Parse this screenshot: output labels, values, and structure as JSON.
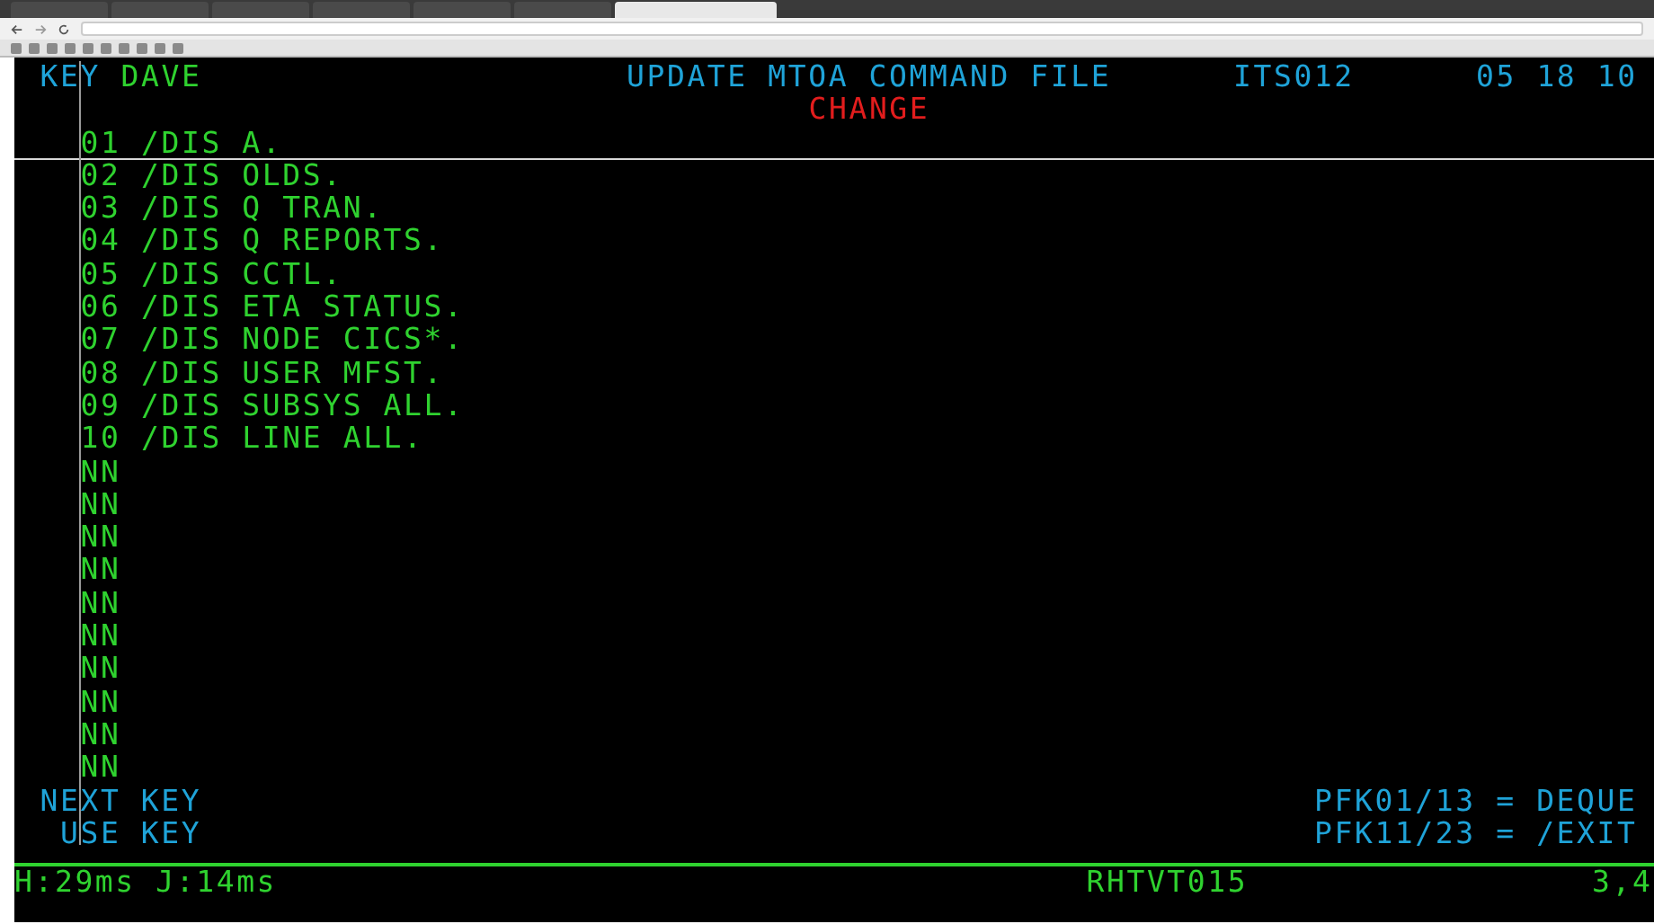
{
  "browser": {
    "tabs": [
      {
        "selected": false
      },
      {
        "selected": false
      },
      {
        "selected": false
      },
      {
        "selected": false
      },
      {
        "selected": false
      },
      {
        "selected": false
      },
      {
        "selected": true
      }
    ]
  },
  "header": {
    "key_label": "KEY",
    "key_value": "DAVE",
    "title": "UPDATE MTOA COMMAND FILE",
    "program": "ITS012",
    "date": "05 18 10",
    "mode": "CHANGE"
  },
  "entries": [
    {
      "number": "01",
      "command": "/DIS A."
    },
    {
      "number": "02",
      "command": "/DIS OLDS."
    },
    {
      "number": "03",
      "command": "/DIS Q TRAN."
    },
    {
      "number": "04",
      "command": "/DIS Q REPORTS."
    },
    {
      "number": "05",
      "command": "/DIS CCTL."
    },
    {
      "number": "06",
      "command": "/DIS ETA STATUS."
    },
    {
      "number": "07",
      "command": "/DIS NODE CICS*."
    },
    {
      "number": "08",
      "command": "/DIS USER MFST."
    },
    {
      "number": "09",
      "command": "/DIS SUBSYS ALL."
    },
    {
      "number": "10",
      "command": "/DIS LINE ALL."
    },
    {
      "number": "NN"
    },
    {
      "number": "NN"
    },
    {
      "number": "NN"
    },
    {
      "number": "NN"
    },
    {
      "number": "NN"
    },
    {
      "number": "NN"
    },
    {
      "number": "NN"
    },
    {
      "number": "NN"
    },
    {
      "number": "NN"
    },
    {
      "number": "NN"
    }
  ],
  "footer": [
    {
      "label": "NEXT KEY",
      "pfk": "PFK01/13 = DEQUE"
    },
    {
      "label": "USE KEY",
      "pfk": "PFK11/23 = /EXIT"
    }
  ],
  "status_bar": {
    "timing": "H:29ms J:14ms",
    "terminal": "RHTVT015",
    "cursor": "3,4"
  }
}
